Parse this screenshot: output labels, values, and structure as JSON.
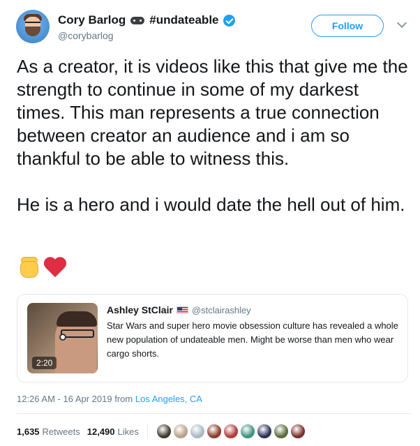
{
  "author": {
    "display_name": "Cory Barlog",
    "name_suffix": "#undateable",
    "handle": "@corybarlog"
  },
  "header": {
    "follow_label": "Follow"
  },
  "tweet": {
    "paragraphs": [
      "As a creator, it is videos like this that give me the strength to continue in some of my darkest times. This man represents a true connection between creator an audience and i am so thankful to be able to witness this.",
      "He is a hero and i would date the hell out of him."
    ],
    "emojis": [
      "raised-fist",
      "red-heart"
    ]
  },
  "quoted_tweet": {
    "display_name": "Ashley StClair",
    "handle": "@stclairashley",
    "text": "Star Wars and super hero movie obsession culture has revealed a whole new population of undateable men. Might be worse than men who wear cargo shorts.",
    "video_duration": "2:20"
  },
  "meta": {
    "timestamp": "12:26 AM - 16 Apr 2019 from",
    "location": "Los Angeles, CA"
  },
  "stats": {
    "retweets_count": "1,635",
    "retweets_label": "Retweets",
    "likes_count": "12,490",
    "likes_label": "Likes"
  },
  "liker_avatar_colors": [
    "#3d3a2c",
    "#b8a08a",
    "#aab8c2",
    "#8a3b2a",
    "#b03a3a",
    "#3f8f7f",
    "#2b2f5a",
    "#5a6a3a",
    "#7a2f2a"
  ]
}
